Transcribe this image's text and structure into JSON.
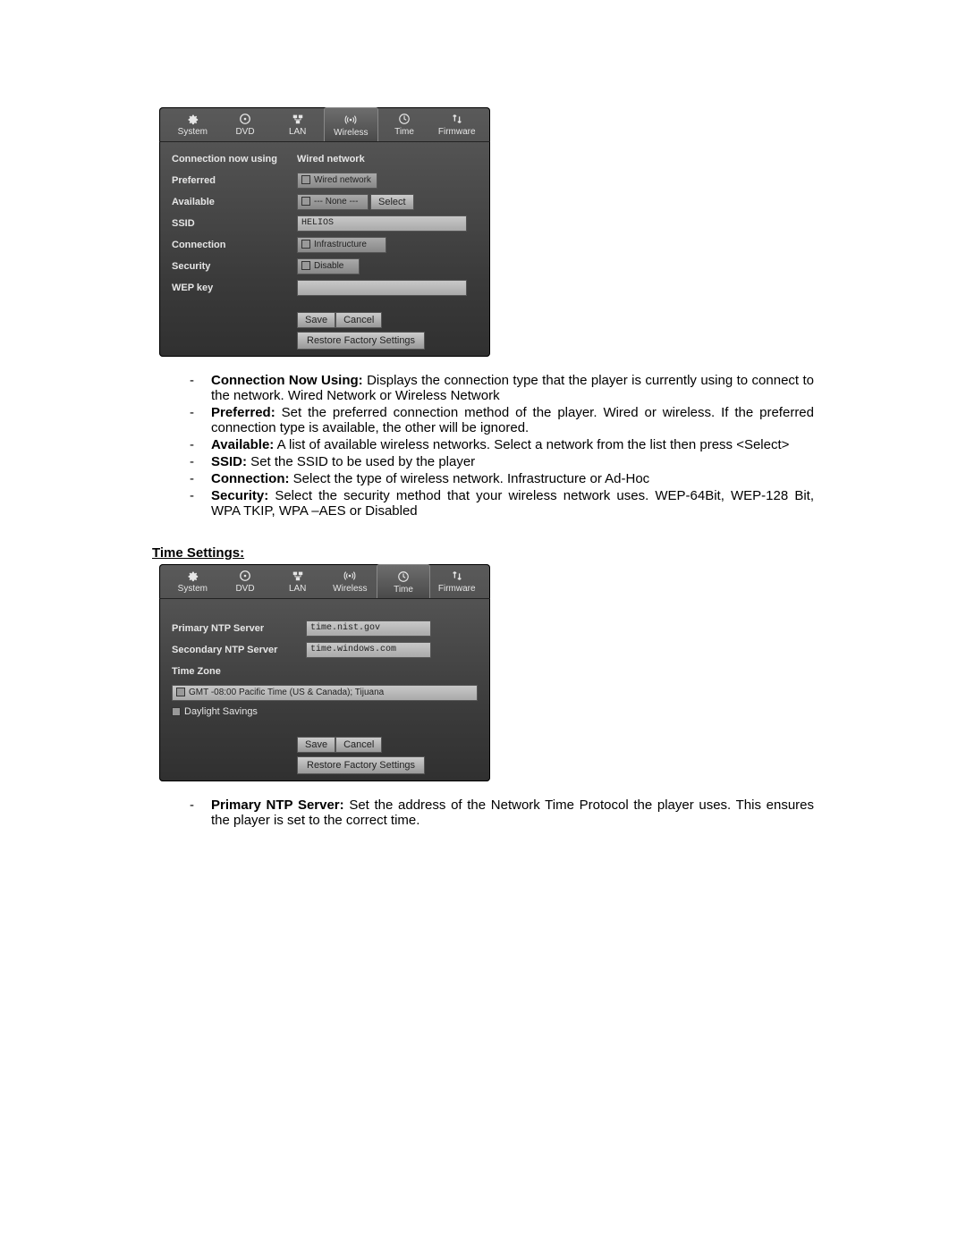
{
  "tabs": {
    "system": "System",
    "dvd": "DVD",
    "lan": "LAN",
    "wireless": "Wireless",
    "time": "Time",
    "firmware": "Firmware"
  },
  "wireless_panel": {
    "rows": {
      "conn_now_lbl": "Connection now using",
      "conn_now_val": "Wired network",
      "preferred_lbl": "Preferred",
      "preferred_val": "Wired network",
      "available_lbl": "Available",
      "available_val": "--- None ---",
      "select_btn": "Select",
      "ssid_lbl": "SSID",
      "ssid_val": "HELIOS",
      "connection_lbl": "Connection",
      "connection_val": "Infrastructure",
      "security_lbl": "Security",
      "security_val": "Disable",
      "wep_lbl": "WEP key",
      "wep_val": ""
    },
    "save_btn": "Save",
    "cancel_btn": "Cancel",
    "restore_btn": "Restore Factory Settings"
  },
  "wireless_desc": {
    "i0_b": "Connection Now Using:",
    "i0_t": " Displays the connection type that the player is currently using to connect to the network. Wired Network or Wireless Network",
    "i1_b": "Preferred:",
    "i1_t": " Set the preferred connection method of the player. Wired or wireless. If the preferred connection type is available, the other will be ignored.",
    "i2_b": "Available:",
    "i2_t": " A list of available wireless networks. Select a network from the list then press <Select>",
    "i3_b": "SSID:",
    "i3_t": " Set the SSID to be used by the player",
    "i4_b": "Connection:",
    "i4_t": " Select the type of wireless network. Infrastructure or Ad-Hoc",
    "i5_b": "Security:",
    "i5_t": " Select the security method that your wireless network uses. WEP-64Bit, WEP-128 Bit, WPA TKIP, WPA –AES or Disabled"
  },
  "time_heading": "Time Settings:",
  "time_panel": {
    "rows": {
      "primary_lbl": "Primary NTP Server",
      "primary_val": "time.nist.gov",
      "secondary_lbl": "Secondary NTP Server",
      "secondary_val": "time.windows.com",
      "tz_lbl": "Time Zone",
      "tz_val": "GMT -08:00 Pacific Time (US & Canada); Tijuana",
      "dst_lbl": "Daylight Savings"
    },
    "save_btn": "Save",
    "cancel_btn": "Cancel",
    "restore_btn": "Restore Factory Settings"
  },
  "time_desc": {
    "i0_b": "Primary NTP Server:",
    "i0_t": " Set the address of the Network Time Protocol the player uses. This ensures the player is set to the correct time."
  }
}
